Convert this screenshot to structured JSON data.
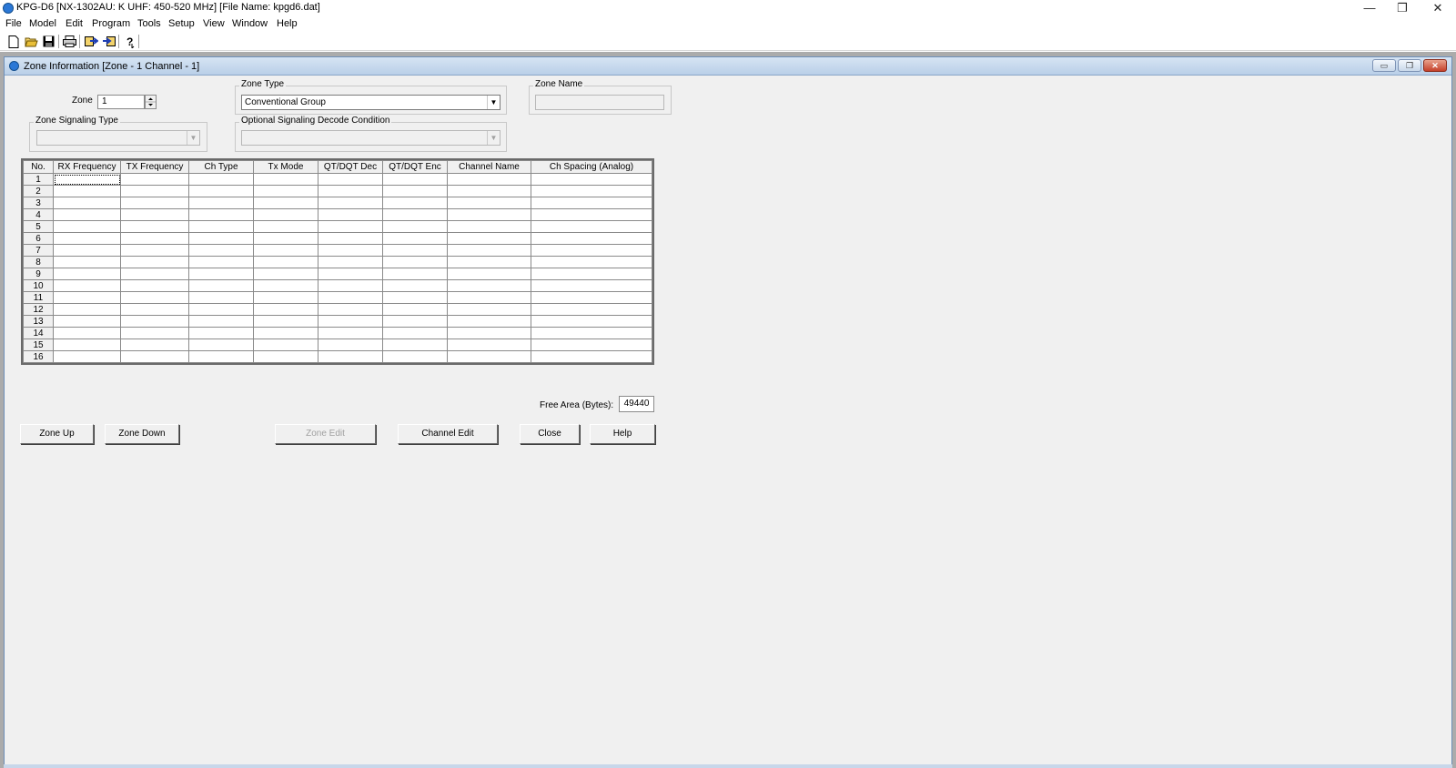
{
  "window": {
    "title": "KPG-D6 [NX-1302AU: K UHF: 450-520 MHz] [File Name: kpgd6.dat]",
    "minimize": "—",
    "maximize": "❐",
    "close": "✕"
  },
  "menu": [
    "File",
    "Model",
    "Edit",
    "Program",
    "Tools",
    "Setup",
    "View",
    "Window",
    "Help"
  ],
  "toolbar": {
    "icons": [
      "new-file-icon",
      "open-folder-icon",
      "save-disk-icon",
      "print-icon",
      "read-from-radio-icon",
      "write-to-radio-icon",
      "help-pointer-icon"
    ]
  },
  "child": {
    "title": "Zone Information [Zone - 1   Channel  -  1]",
    "min": "▭",
    "restore": "❐",
    "close": "✕"
  },
  "form": {
    "zone_label": "Zone",
    "zone_value": "1",
    "zone_type_label": "Zone Type",
    "zone_type_value": "Conventional Group",
    "zone_name_label": "Zone Name",
    "zone_name_value": "",
    "zone_signaling_label": "Zone Signaling Type",
    "zone_signaling_value": "",
    "optional_signaling_label": "Optional Signaling Decode Condition",
    "optional_signaling_value": ""
  },
  "grid": {
    "columns": [
      "No.",
      "RX Frequency",
      "TX Frequency",
      "Ch Type",
      "Tx Mode",
      "QT/DQT Dec",
      "QT/DQT Enc",
      "Channel Name",
      "Ch Spacing (Analog)"
    ],
    "rows": [
      "1",
      "2",
      "3",
      "4",
      "5",
      "6",
      "7",
      "8",
      "9",
      "10",
      "11",
      "12",
      "13",
      "14",
      "15",
      "16"
    ]
  },
  "free_area": {
    "label": "Free Area (Bytes):",
    "value": "49440"
  },
  "buttons": {
    "zone_up": "Zone Up",
    "zone_down": "Zone Down",
    "zone_edit": "Zone Edit",
    "channel_edit": "Channel Edit",
    "close": "Close",
    "help": "Help"
  }
}
